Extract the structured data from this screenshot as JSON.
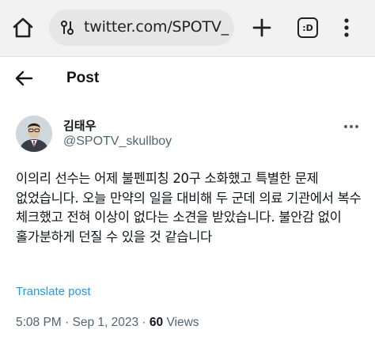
{
  "browser": {
    "url": "twitter.com/SPOTV_",
    "tabs_label": ":D",
    "icons": [
      "home-icon",
      "lock-icon",
      "plus-icon",
      "tab-switcher-icon",
      "more-vert-icon"
    ]
  },
  "header": {
    "title": "Post",
    "back_icon": "arrow-left-icon"
  },
  "author": {
    "name": "김태우",
    "handle": "@SPOTV_skullboy"
  },
  "tweet": {
    "text": "이의리 선수는 어제 불펜피칭 20구 소화했고 특별한 문제 없었습니다. 오늘 만약의 일을 대비해 두 군데 의료 기관에서 복수 체크했고 전혀 이상이 없다는 소견을 받았습니다. 불안감 없이 홀가분하게 던질 수 있을 것 같습니다",
    "translate_label": "Translate post"
  },
  "meta": {
    "time": "5:08 PM",
    "sep1": " · ",
    "date": "Sep 1, 2023",
    "sep2": " · ",
    "views_count": "60",
    "views_label": " Views"
  },
  "colors": {
    "link": "#1d9bf0",
    "secondary_text": "#536471",
    "primary_text": "#0f1419",
    "chrome_bg": "#f2f2f2"
  }
}
